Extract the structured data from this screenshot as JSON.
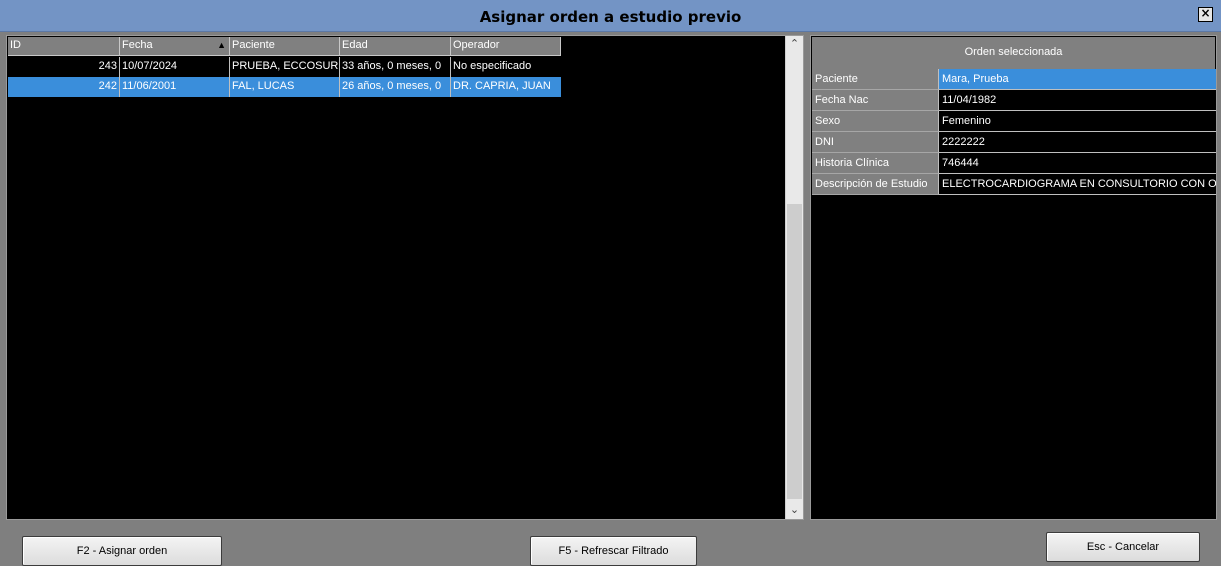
{
  "window": {
    "title": "Asignar orden a estudio previo",
    "close_glyph": "×"
  },
  "grid": {
    "columns": [
      "ID",
      "Fecha",
      "Paciente",
      "Edad",
      "Operador"
    ],
    "sort_glyph": "▲",
    "rows": [
      {
        "id": "243",
        "fecha": "10/07/2024",
        "paciente": "PRUEBA, ECCOSUR",
        "edad": "33 años, 0 meses, 0",
        "operador": "No especificado",
        "selected": false
      },
      {
        "id": "242",
        "fecha": "11/06/2001",
        "paciente": "FAL, LUCAS",
        "edad": "26 años, 0 meses, 0",
        "operador": "DR. CAPRIA, JUAN",
        "selected": true
      }
    ],
    "scroll_up_glyph": "⌃",
    "scroll_down_glyph": "⌄"
  },
  "detail": {
    "header": "Orden seleccionada",
    "fields": [
      {
        "label": "Paciente",
        "value": "Mara, Prueba"
      },
      {
        "label": "Fecha Nac",
        "value": "11/04/1982"
      },
      {
        "label": "Sexo",
        "value": "Femenino"
      },
      {
        "label": "DNI",
        "value": "2222222"
      },
      {
        "label": "Historia Clínica",
        "value": "746444"
      },
      {
        "label": "Descripción de Estudio",
        "value": "ELECTROCARDIOGRAMA EN CONSULTORIO CON O"
      }
    ]
  },
  "buttons": {
    "assign": "F2 - Asignar orden",
    "refresh": "F5 - Refrescar Filtrado",
    "cancel": "Esc - Cancelar"
  },
  "colors": {
    "titlebar": "#7394c5",
    "selection": "#3a8edb",
    "background": "#7f7f7f"
  }
}
